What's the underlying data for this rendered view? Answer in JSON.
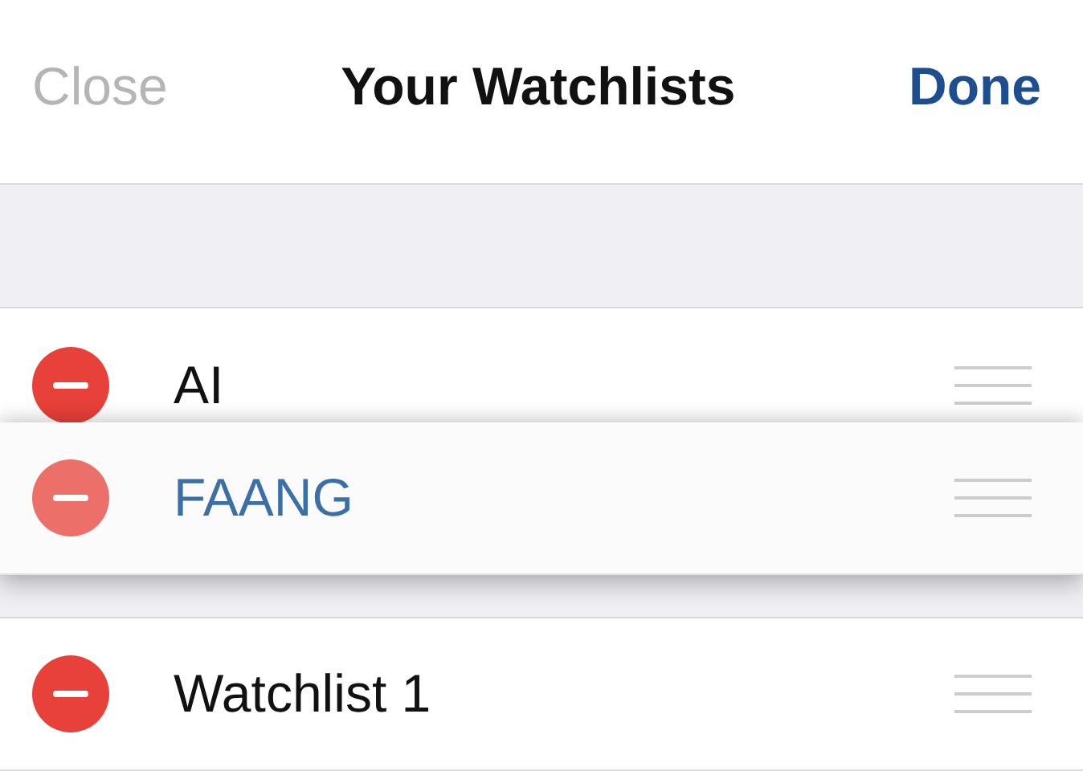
{
  "nav": {
    "close": {
      "label": "Close",
      "disabled": true
    },
    "title": "Your Watchlists",
    "done": {
      "label": "Done",
      "disabled": false
    }
  },
  "watchlists": [
    {
      "name": "AI",
      "dragging": false
    },
    {
      "name": "FAANG",
      "dragging": true
    },
    {
      "name": "Watchlist 1",
      "dragging": false
    }
  ]
}
